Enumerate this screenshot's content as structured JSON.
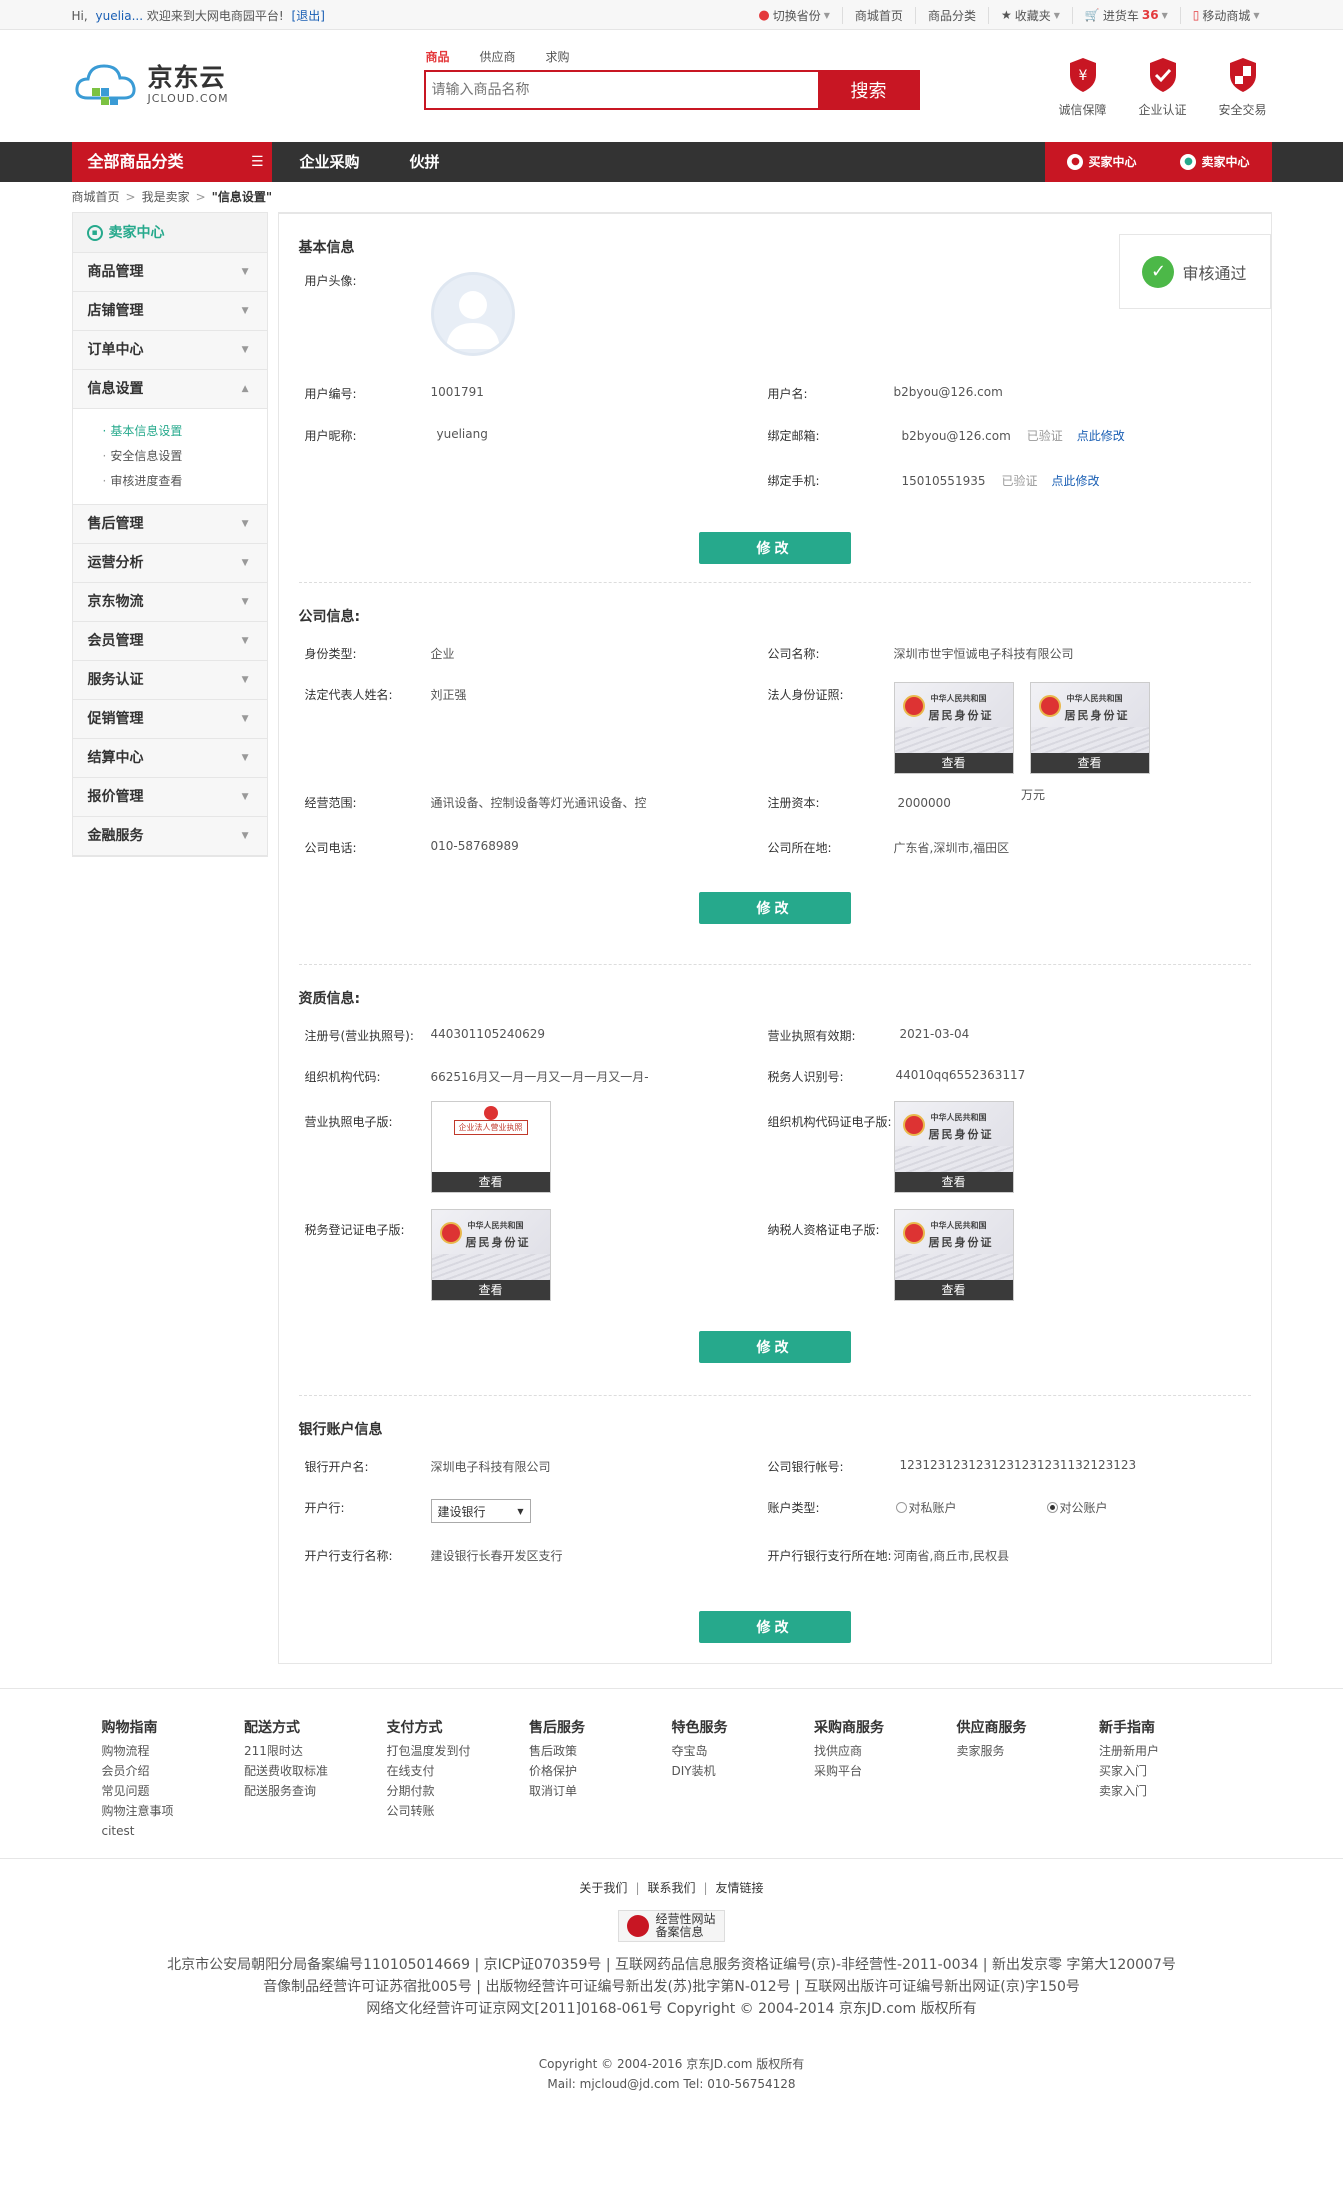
{
  "topbar": {
    "hi": "Hi,",
    "user": "yuelia...",
    "welcome": "欢迎来到大网电商园平台!",
    "logout": "[退出]",
    "location": "切换省份",
    "mall_home": "商城首页",
    "categories": "商品分类",
    "favorites": "收藏夹",
    "cart_label": "进货车",
    "cart_count": "36",
    "mobile": "移动商城"
  },
  "logo": {
    "cn": "京东云",
    "en": "JCLOUD.COM"
  },
  "search": {
    "tabs": [
      "商品",
      "供应商",
      "求购"
    ],
    "placeholder": "请输入商品名称",
    "button": "搜索"
  },
  "guarantees": [
    "诚信保障",
    "企业认证",
    "安全交易"
  ],
  "nav": {
    "all_categories": "全部商品分类",
    "links": [
      "企业采购",
      "伙拼"
    ],
    "buyer_center": "买家中心",
    "seller_center": "卖家中心"
  },
  "breadcrumb": [
    "商城首页",
    "我是卖家",
    "\"信息设置\""
  ],
  "sidebar": {
    "head": "卖家中心",
    "items_top": [
      "商品管理",
      "店铺管理",
      "订单中心",
      "信息设置"
    ],
    "sub": [
      "基本信息设置",
      "安全信息设置",
      "审核进度查看"
    ],
    "items_bottom": [
      "售后管理",
      "运营分析",
      "京东物流",
      "会员管理",
      "服务认证",
      "促销管理",
      "结算中心",
      "报价管理",
      "金融服务"
    ]
  },
  "status": "审核通过",
  "edit_label": "修改",
  "view_label": "查看",
  "basic": {
    "title": "基本信息",
    "avatar_label": "用户头像:",
    "user_no_label": "用户编号:",
    "user_no": "1001791",
    "username_label": "用户名:",
    "username": "b2byou@126.com",
    "nickname_label": "用户昵称:",
    "nickname": "yueliang",
    "email_label": "绑定邮箱:",
    "email": "b2byou@126.com",
    "phone_label": "绑定手机:",
    "phone": "15010551935",
    "verified": "已验证",
    "edit_link": "点此修改"
  },
  "company": {
    "title": "公司信息:",
    "type_label": "身份类型:",
    "type": "企业",
    "name_label": "公司名称:",
    "name": "深圳市世宇恒诚电子科技有限公司",
    "rep_label": "法定代表人姓名:",
    "rep": "刘正强",
    "id_label": "法人身份证照:",
    "scope_label": "经营范围:",
    "scope": "通讯设备、控制设备等灯光通讯设备、控",
    "capital_label": "注册资本:",
    "capital": "2000000",
    "capital_unit": "万元",
    "phone_label": "公司电话:",
    "phone": "010-58768989",
    "location_label": "公司所在地:",
    "location": "广东省,深圳市,福田区",
    "card_t1": "中华人民共和国",
    "card_t2": "居民身份证"
  },
  "qualification": {
    "title": "资质信息:",
    "reg_label": "注册号(营业执照号):",
    "reg": "440301105240629",
    "expiry_label": "营业执照有效期:",
    "expiry": "2021-03-04",
    "org_label": "组织机构代码:",
    "org": "662516月又一月一月又一月一月又一月-",
    "tax_label": "税务人识别号:",
    "tax": "44010qq6552363117",
    "license_img_label": "营业执照电子版:",
    "license_title": "企业法人营业执照",
    "org_img_label": "组织机构代码证电子版:",
    "tax_img_label": "税务登记证电子版:",
    "taxpayer_img_label": "纳税人资格证电子版:"
  },
  "bank": {
    "title": "银行账户信息",
    "holder_label": "银行开户名:",
    "holder": "深圳电子科技有限公司",
    "account_label": "公司银行帐号:",
    "account": "1231231231231231231231132123123",
    "bank_label": "开户行:",
    "bank": "建设银行",
    "type_label": "账户类型:",
    "type_private": "对私账户",
    "type_public": "对公账户",
    "branch_label": "开户行支行名称:",
    "branch": "建设银行长春开发区支行",
    "branch_loc_label": "开户行银行支行所在地:",
    "branch_loc": "河南省,商丘市,民权县"
  },
  "footer": {
    "columns": [
      {
        "title": "购物指南",
        "items": [
          "购物流程",
          "会员介绍",
          "常见问题",
          "购物注意事项",
          "citest"
        ]
      },
      {
        "title": "配送方式",
        "items": [
          "211限时达",
          "配送费收取标准",
          "配送服务查询"
        ]
      },
      {
        "title": "支付方式",
        "items": [
          "打包温度发到付",
          "在线支付",
          "分期付款",
          "公司转账"
        ]
      },
      {
        "title": "售后服务",
        "items": [
          "售后政策",
          "价格保护",
          "取消订单"
        ]
      },
      {
        "title": "特色服务",
        "items": [
          "夺宝岛",
          "DIY装机"
        ]
      },
      {
        "title": "采购商服务",
        "items": [
          "找供应商",
          "采购平台"
        ]
      },
      {
        "title": "供应商服务",
        "items": [
          "卖家服务"
        ]
      },
      {
        "title": "新手指南",
        "items": [
          "注册新用户",
          "买家入门",
          "卖家入门"
        ]
      }
    ],
    "bottom_links": [
      "关于我们",
      "联系我们",
      "友情链接"
    ],
    "badge_line1": "经营性网站",
    "badge_line2": "备案信息",
    "lic1": "北京市公安局朝阳分局备案编号110105014669 | 京ICP证070359号 | 互联网药品信息服务资格证编号(京)-非经营性-2011-0034 | 新出发京零 字第大120007号",
    "lic2": "音像制品经营许可证苏宿批005号 | 出版物经营许可证编号新出发(苏)批字第N-012号 | 互联网出版许可证编号新出网证(京)字150号",
    "lic3": "网络文化经营许可证京网文[2011]0168-061号 Copyright © 2004-2014 京东JD.com 版权所有",
    "copyright": "Copyright © 2004-2016 京东JD.com 版权所有",
    "contact": "Mail: mjcloud@jd.com Tel: 010-56754128"
  },
  "colors": {
    "brand_red": "#c81623",
    "accent_green": "#26a98c",
    "link_blue": "#1a5fb4",
    "ok_green": "#4cb848"
  }
}
